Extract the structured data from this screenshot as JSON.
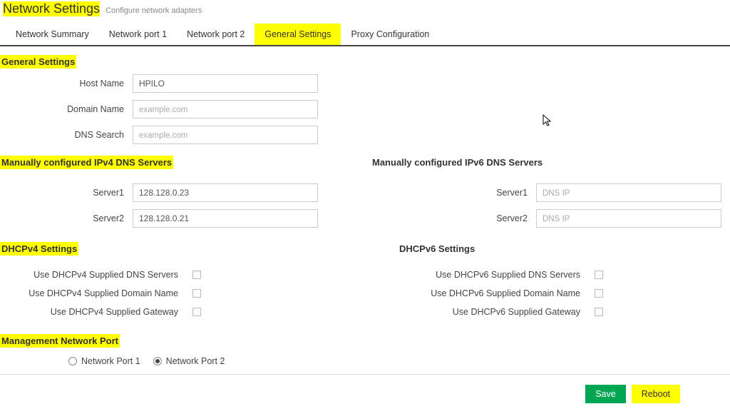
{
  "header": {
    "title": "Network Settings",
    "subtitle": "Configure network adapters"
  },
  "tabs": {
    "items": [
      {
        "label": "Network Summary"
      },
      {
        "label": "Network port 1"
      },
      {
        "label": "Network port 2"
      },
      {
        "label": "General Settings"
      },
      {
        "label": "Proxy Configuration"
      }
    ],
    "active_index": 3
  },
  "sections": {
    "general": {
      "heading": "General Settings",
      "host_name_label": "Host Name",
      "host_name_value": "HPILO",
      "domain_name_label": "Domain Name",
      "domain_name_value": "",
      "domain_name_placeholder": "example.com",
      "dns_search_label": "DNS Search",
      "dns_search_value": "",
      "dns_search_placeholder": "example.com"
    },
    "dns4": {
      "heading": "Manually configured IPv4 DNS Servers",
      "s1_label": "Server1",
      "s1_value": "128.128.0.23",
      "s2_label": "Server2",
      "s2_value": "128.128.0.21"
    },
    "dns6": {
      "heading": "Manually configured IPv6 DNS Servers",
      "s1_label": "Server1",
      "s1_value": "",
      "s1_placeholder": "DNS IP",
      "s2_label": "Server2",
      "s2_value": "",
      "s2_placeholder": "DNS IP"
    },
    "dhcpv4": {
      "heading": "DHCPv4 Settings",
      "dns_label": "Use DHCPv4 Supplied DNS Servers",
      "domain_label": "Use DHCPv4 Supplied Domain Name",
      "gateway_label": "Use DHCPv4 Supplied Gateway",
      "dns_checked": false,
      "domain_checked": false,
      "gateway_checked": false
    },
    "dhcpv6": {
      "heading": "DHCPv6 Settings",
      "dns_label": "Use DHCPv6 Supplied DNS Servers",
      "domain_label": "Use DHCPv6 Supplied Domain Name",
      "gateway_label": "Use DHCPv6 Supplied Gateway",
      "dns_checked": false,
      "domain_checked": false,
      "gateway_checked": false
    },
    "mgmt_port": {
      "heading": "Management Network Port",
      "opt1_label": "Network Port 1",
      "opt2_label": "Network Port 2",
      "selected": "opt2"
    }
  },
  "footer": {
    "save_label": "Save",
    "reboot_label": "Reboot"
  }
}
